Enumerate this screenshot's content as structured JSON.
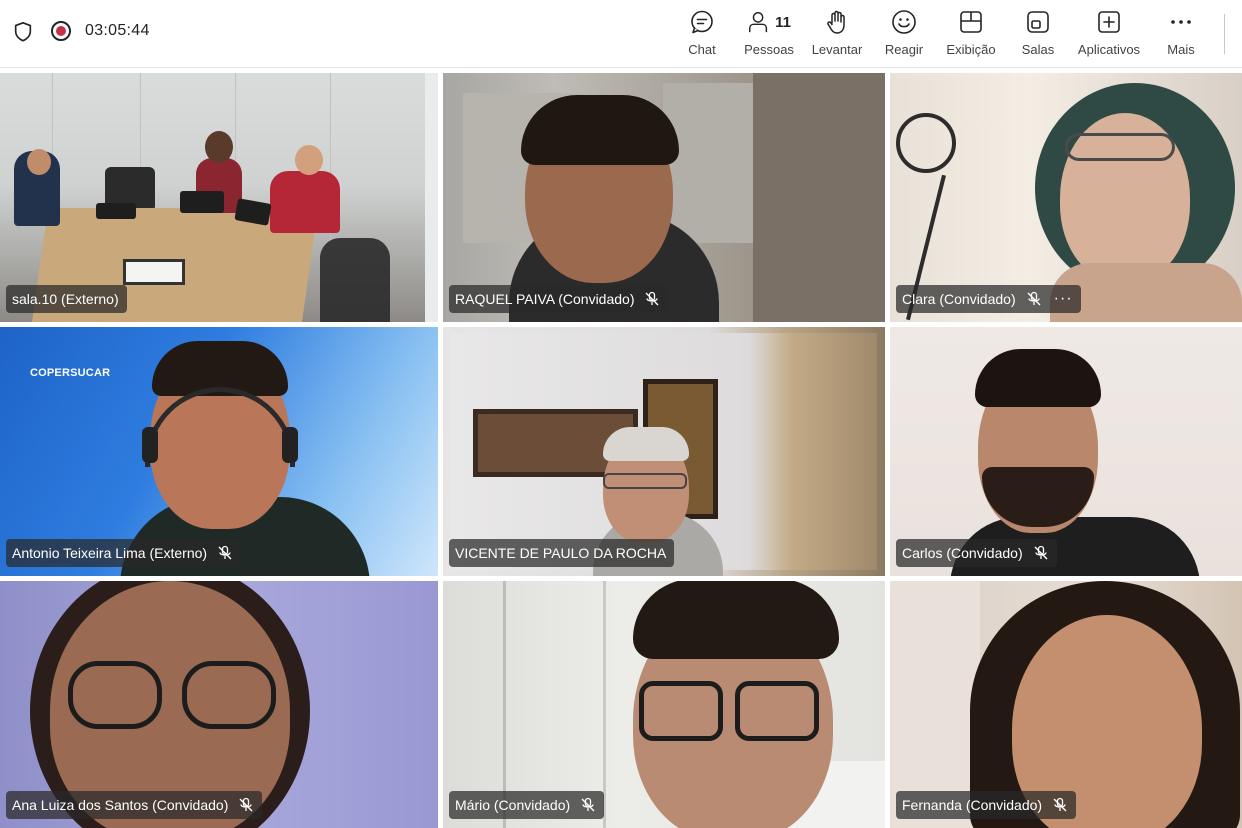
{
  "header": {
    "timer": "03:05:44",
    "tools": [
      {
        "label": "Chat",
        "icon": "chat-icon"
      },
      {
        "label": "Pessoas",
        "icon": "people-icon",
        "count": "11"
      },
      {
        "label": "Levantar",
        "icon": "raise-hand-icon"
      },
      {
        "label": "Reagir",
        "icon": "react-icon"
      },
      {
        "label": "Exibição",
        "icon": "view-icon"
      },
      {
        "label": "Salas",
        "icon": "rooms-icon"
      },
      {
        "label": "Aplicativos",
        "icon": "apps-icon"
      },
      {
        "label": "Mais",
        "icon": "more-icon"
      }
    ]
  },
  "participants": [
    {
      "name": "sala.10 (Externo)",
      "muted": false
    },
    {
      "name": "RAQUEL PAIVA (Convidado)",
      "muted": true
    },
    {
      "name": "Clara (Convidado)",
      "muted": true,
      "more": "···"
    },
    {
      "name": "Antonio Teixeira Lima (Externo)",
      "muted": true,
      "background_logo": "COPERSUCAR"
    },
    {
      "name": "VICENTE DE PAULO DA ROCHA",
      "muted": false,
      "active": true
    },
    {
      "name": "Carlos (Convidado)",
      "muted": true
    },
    {
      "name": "Ana Luiza dos Santos (Convidado)",
      "muted": true
    },
    {
      "name": "Mário (Convidado)",
      "muted": true
    },
    {
      "name": "Fernanda (Convidado)",
      "muted": true
    }
  ],
  "colors": {
    "active_border": "#5b5fc7",
    "record_dot": "#c4314b"
  }
}
